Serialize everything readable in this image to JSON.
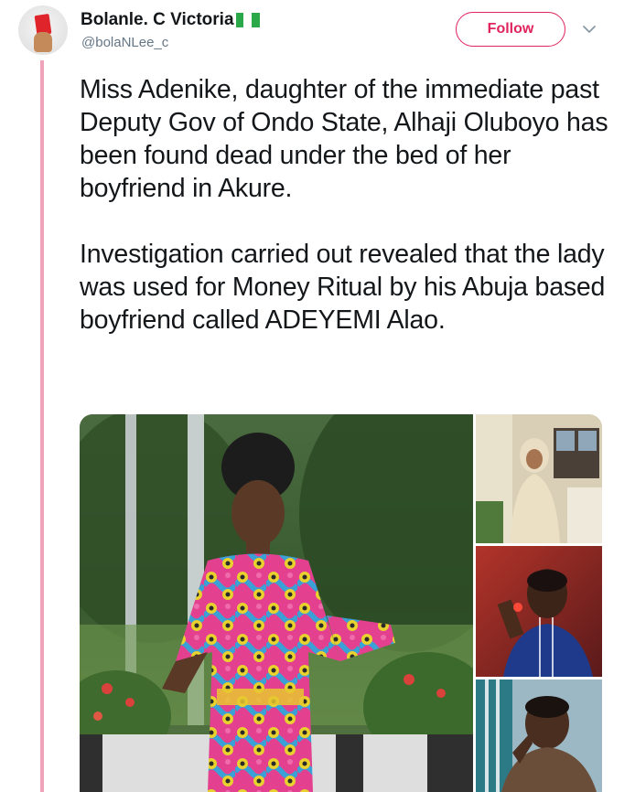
{
  "author": {
    "display_name": "Bolanle. C Victoria",
    "handle": "@bolaNLee_c",
    "flag_colors": [
      "#2aa84a",
      "#ffffff",
      "#2aa84a"
    ]
  },
  "actions": {
    "follow_label": "Follow",
    "more_icon": "chevron-down-icon"
  },
  "tweet": {
    "paragraphs": [
      "Miss Adenike, daughter of the immediate past Deputy Gov of Ondo State, Alhaji Oluboyo has been found dead under the bed of her boyfriend in Akure.",
      "Investigation carried out revealed that the lady was used for Money Ritual by his Abuja based boyfriend called ADEYEMI Alao."
    ]
  },
  "colors": {
    "accent": "#e0245e",
    "thread_line": "#f0a4bb",
    "text": "#14171a",
    "secondary_text": "#657786"
  }
}
